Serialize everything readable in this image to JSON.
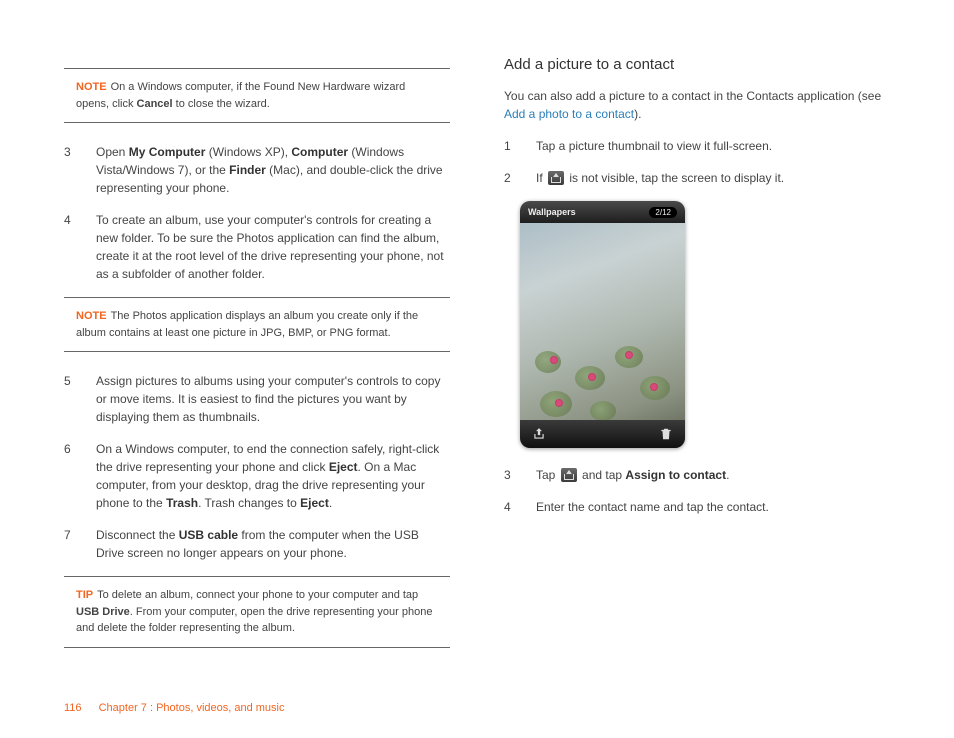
{
  "left": {
    "note1": {
      "label": "NOTE",
      "text_a": "On a Windows computer, if the Found New Hardware wizard opens, click ",
      "bold": "Cancel",
      "text_b": " to close the wizard."
    },
    "step3": {
      "num": "3",
      "pre": "Open ",
      "b1": "My Computer",
      "mid1": " (Windows XP), ",
      "b2": "Computer",
      "mid2": " (Windows Vista/Windows 7), or the ",
      "b3": "Finder",
      "post": " (Mac), and double-click the drive representing your phone."
    },
    "step4": {
      "num": "4",
      "text": "To create an album, use your computer's controls for creating a new folder. To be sure the Photos application can find the album, create it at the root level of the drive representing your phone, not as a subfolder of another folder."
    },
    "note2": {
      "label": "NOTE",
      "text": "The Photos application displays an album you create only if the album contains at least one picture in JPG, BMP, or PNG format."
    },
    "step5": {
      "num": "5",
      "text": "Assign pictures to albums using your computer's controls to copy or move items. It is easiest to find the pictures you want by displaying them as thumbnails."
    },
    "step6": {
      "num": "6",
      "pre": "On a Windows computer, to end the connection safely, right-click the drive representing your phone and click ",
      "b1": "Eject",
      "mid1": ". On a Mac computer, from your desktop, drag the drive representing your phone to the ",
      "b2": "Trash",
      "mid2": ". Trash changes to ",
      "b3": "Eject",
      "post": "."
    },
    "step7": {
      "num": "7",
      "pre": "Disconnect the ",
      "b1": "USB cable",
      "post": " from the computer when the USB Drive screen no longer appears on your phone."
    },
    "tip": {
      "label": "TIP",
      "text_a": "To delete an album, connect your phone to your computer and tap ",
      "bold": "USB Drive",
      "text_b": ". From your computer, open the drive representing your phone and delete the folder representing the album."
    }
  },
  "right": {
    "heading": "Add a picture to a contact",
    "intro_a": "You can also add a picture to a contact in the Contacts application (see ",
    "intro_link": "Add a photo to a contact",
    "intro_b": ").",
    "step1": {
      "num": "1",
      "text": "Tap a picture thumbnail to view it full-screen."
    },
    "step2": {
      "num": "2",
      "pre": "If ",
      "post": " is not visible, tap the screen to display it."
    },
    "phone": {
      "title": "Wallpapers",
      "count": "2/12"
    },
    "step3": {
      "num": "3",
      "pre": "Tap ",
      "mid": " and tap ",
      "b1": "Assign to contact",
      "post": "."
    },
    "step4": {
      "num": "4",
      "text": "Enter the contact name and tap the contact."
    }
  },
  "footer": {
    "page": "116",
    "chapter": "Chapter 7 : Photos, videos, and music"
  }
}
